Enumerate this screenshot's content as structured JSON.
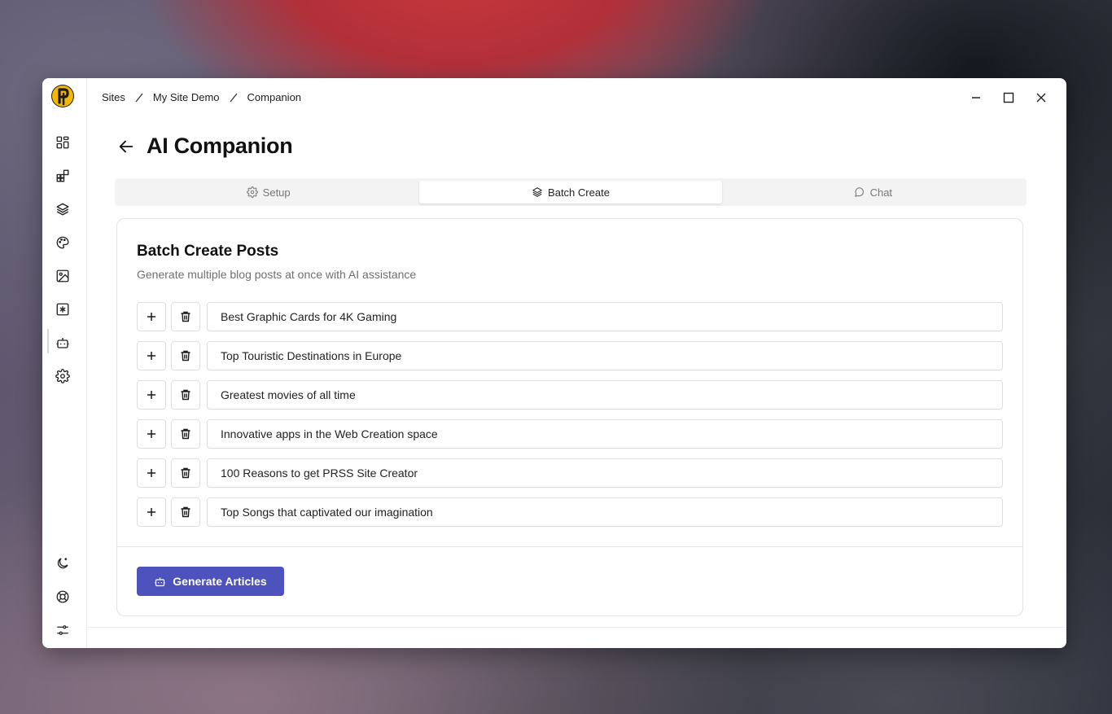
{
  "breadcrumbs": [
    "Sites",
    "My Site Demo",
    "Companion"
  ],
  "page": {
    "title": "AI Companion"
  },
  "tabs": [
    {
      "label": "Setup",
      "icon": "gear-icon",
      "active": false
    },
    {
      "label": "Batch Create",
      "icon": "layers-icon",
      "active": true
    },
    {
      "label": "Chat",
      "icon": "chat-bubble-icon",
      "active": false
    }
  ],
  "card": {
    "title": "Batch Create Posts",
    "subtitle": "Generate multiple blog posts at once with AI assistance"
  },
  "posts": [
    "Best Graphic Cards for 4K Gaming",
    "Top Touristic Destinations in Europe",
    "Greatest movies of all time",
    "Innovative apps in the Web Creation space",
    "100 Reasons to get PRSS Site Creator",
    "Top Songs that captivated our imagination"
  ],
  "actions": {
    "generate_label": "Generate Articles"
  },
  "sidebar": {
    "icons": [
      "dashboard-icon",
      "blocks-icon",
      "layers-icon",
      "palette-icon",
      "image-icon",
      "asterisk-icon",
      "robot-icon",
      "gear-icon"
    ],
    "bottom_icons": [
      "moon-icon",
      "lifebuoy-icon",
      "sliders-icon"
    ],
    "active": "robot-icon"
  },
  "colors": {
    "accent": "#4d52bd",
    "logo_accent": "#f5b800"
  }
}
